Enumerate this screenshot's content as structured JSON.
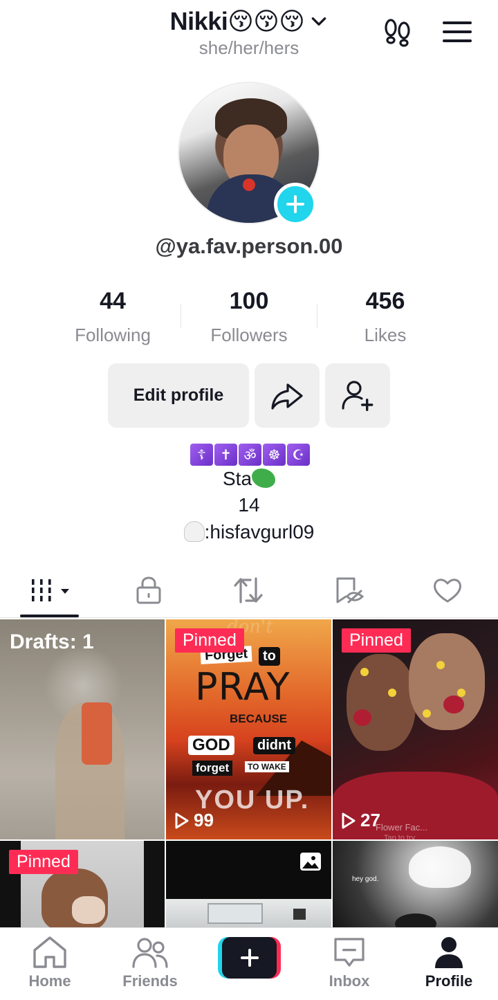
{
  "header": {
    "display_name": "Nikki😚😚😚",
    "pronouns": "she/her/hers"
  },
  "profile": {
    "username": "@ya.fav.person.00"
  },
  "stats": [
    {
      "value": "44",
      "label": "Following"
    },
    {
      "value": "100",
      "label": "Followers"
    },
    {
      "value": "456",
      "label": "Likes"
    }
  ],
  "buttons": {
    "edit_profile": "Edit profile"
  },
  "bio": {
    "symbols": [
      "☦",
      "✝",
      "ॐ",
      "☸",
      "☪"
    ],
    "line1_text": "Sta",
    "line2": "14",
    "line3_text": ":hisfavgurl09"
  },
  "tabs": [
    "videos-grid",
    "private",
    "reposts",
    "favorites",
    "liked"
  ],
  "grid": {
    "drafts_label": "Drafts: 1",
    "pinned_label": "Pinned",
    "tile2_views": "99",
    "tile3_views": "27",
    "tile2_text": {
      "dont": "don't",
      "forget": "Forget",
      "to": "to",
      "pray": "PRAY",
      "because": "BECAUSE",
      "god": "GOD",
      "didnt": "didnt",
      "forget2": "forget",
      "to_wake": "TO WAKE",
      "you_up": "YOU UP."
    },
    "tile3_overlay": "Flower Fac...",
    "tile3_sub": "Tap to try",
    "tile6_caption": "hey god."
  },
  "bottom_nav": [
    {
      "label": "Home"
    },
    {
      "label": "Friends"
    },
    {
      "label": "Inbox"
    },
    {
      "label": "Profile"
    }
  ],
  "colors": {
    "accent_pink": "#fe2c55",
    "accent_cyan": "#20d5ec",
    "text_primary": "#161823",
    "text_secondary": "#8a8b91"
  }
}
